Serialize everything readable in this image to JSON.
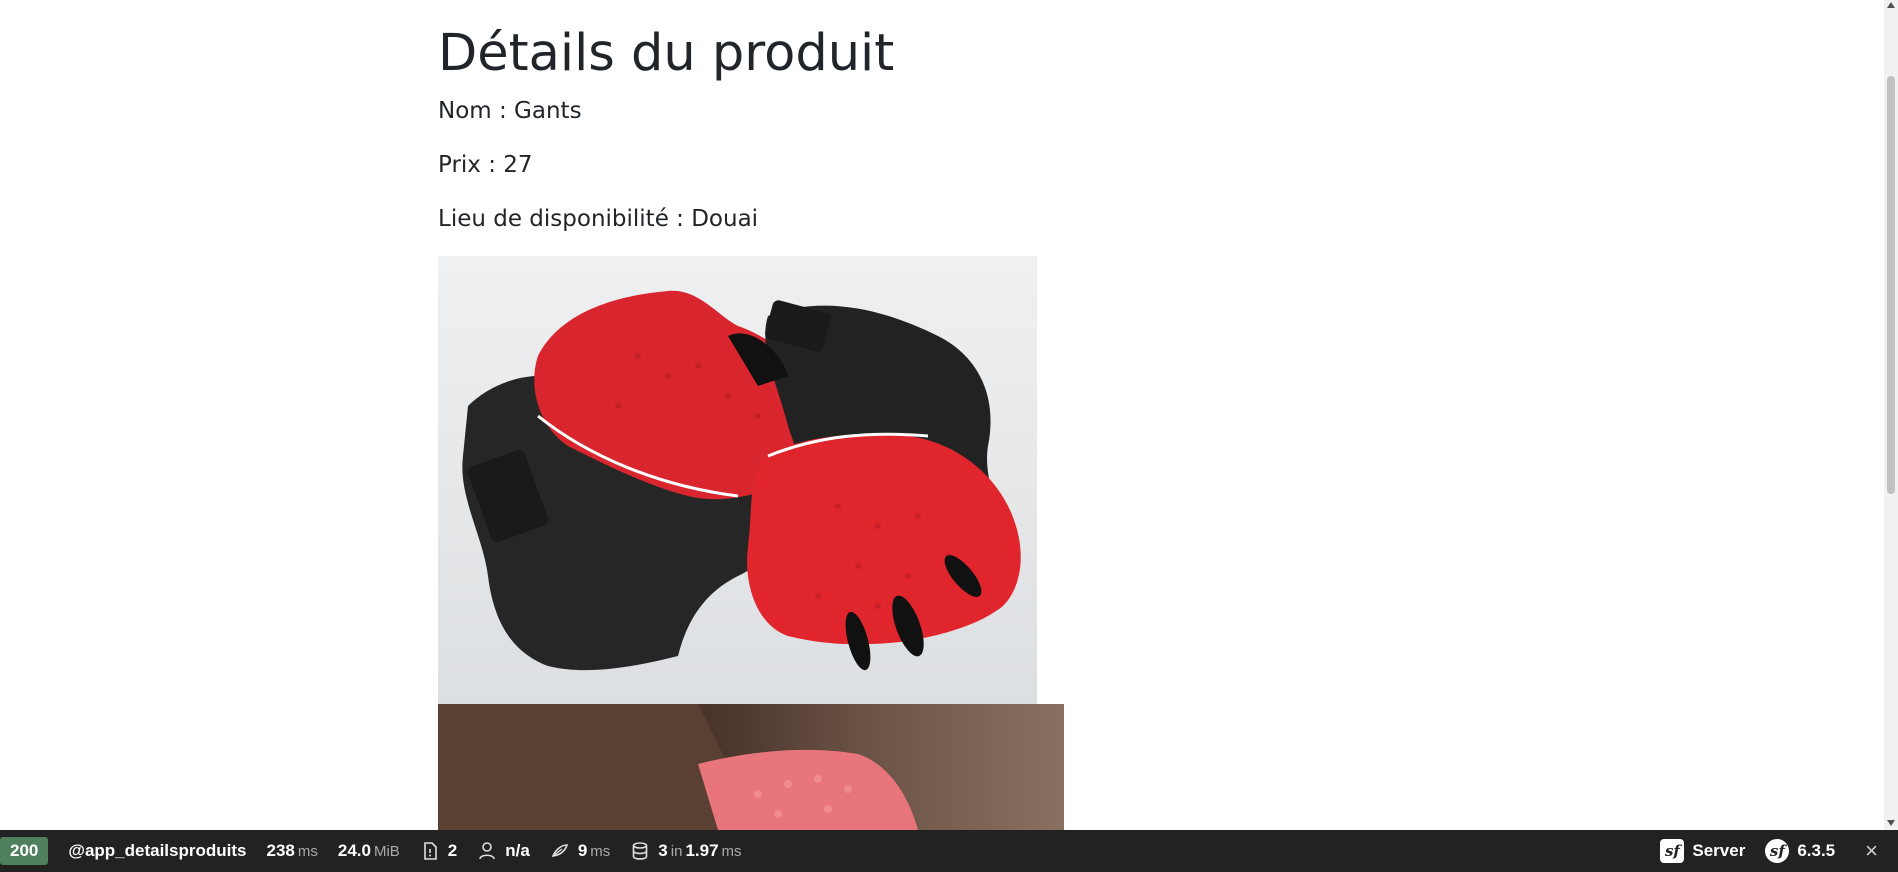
{
  "page": {
    "title": "Détails du produit",
    "nom": "Nom : Gants",
    "prix": "Prix : 27",
    "lieu": "Lieu de disponibilité : Douai"
  },
  "images": {
    "photo1": "red-black-cycling-gloves-photo",
    "photo2": "hand-wearing-glove-photo"
  },
  "toolbar": {
    "status_code": "200",
    "route": "@app_detailsproduits",
    "time_value": "238",
    "time_unit": "ms",
    "memory_value": "24.0",
    "memory_unit": "MiB",
    "logs_count": "2",
    "user": "n/a",
    "twig_value": "9",
    "twig_unit": "ms",
    "db_queries": "3",
    "db_in": "in",
    "db_time": "1.97",
    "db_unit": "ms",
    "server_label": "Server",
    "version": "6.3.5",
    "close_icon": "×"
  },
  "colors": {
    "status_bg": "#4f805d",
    "toolbar_bg": "#222222",
    "text": "#212529"
  }
}
